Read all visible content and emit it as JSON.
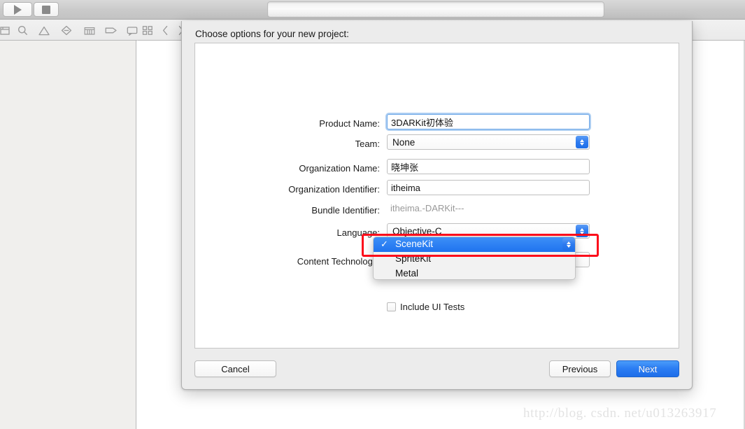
{
  "window": {
    "toolbar": {
      "run_button": "run",
      "stop_button": "stop",
      "activity_text": "",
      "nav_icons": [
        "folder-icon",
        "search-icon",
        "warning-triangle-icon",
        "issue-diamond-icon",
        "test-grid-icon",
        "tag-icon",
        "comment-icon"
      ],
      "seg_icons": [
        "grid-view-icon",
        "chevron-left-icon",
        "chevron-right-icon"
      ]
    }
  },
  "sheet": {
    "title": "Choose options for your new project:",
    "fields": [
      {
        "label": "Product Name:",
        "value": "3DARKit初体验",
        "type": "text",
        "focused": true
      },
      {
        "label": "Team:",
        "value": "None",
        "type": "popup"
      },
      {
        "label": "Organization Name:",
        "value": "晓坤张",
        "type": "text",
        "focused": false
      },
      {
        "label": "Organization Identifier:",
        "value": "itheima",
        "type": "text",
        "focused": false
      },
      {
        "label": "Bundle Identifier:",
        "value": "itheima.-DARKit---",
        "type": "static"
      },
      {
        "label": "Language:",
        "value": "Objective-C",
        "type": "popup"
      },
      {
        "label": "Content Technology:",
        "value": "SceneKit",
        "type": "popup"
      }
    ],
    "occluded_checkbox": {
      "label": "Include UI Tests",
      "checked": false
    },
    "dropdown": {
      "open": true,
      "selected": "SceneKit",
      "check_glyph": "✓",
      "options": [
        "SceneKit",
        "SpriteKit",
        "Metal"
      ]
    },
    "annotation": {
      "type": "red-rectangle",
      "color": "#fc0d1b",
      "targets": "content-technology-dropdown-selected-row"
    },
    "footer": {
      "cancel_label": "Cancel",
      "previous_label": "Previous",
      "next_label": "Next"
    }
  },
  "watermark": {
    "text": "http://blog. csdn. net/u013263917"
  },
  "colors": {
    "accent_blue": "#2b7df3",
    "selection_blue": "#1f73ef",
    "annotation_red": "#fc0d1b",
    "sheet_bg": "#ececec",
    "navigator_bg": "#f0efed"
  }
}
